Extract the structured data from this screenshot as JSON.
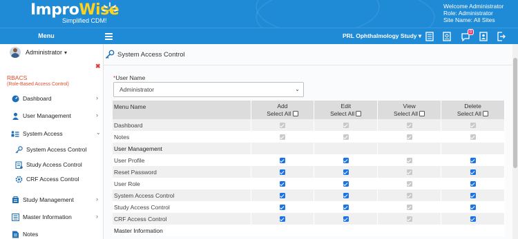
{
  "header": {
    "logo_part1": "Impro",
    "logo_part2": "Wise",
    "logo_tagline": "Simplified CDM!",
    "welcome_line": "Welcome  Administrator",
    "role_line": "Role:  Administrator",
    "site_line": "Site Name:  All Sites",
    "brand_color": "#1f8ad6",
    "accent_color": "#ffd21c"
  },
  "navbar": {
    "menu_label": "Menu",
    "study_selector": "PRL Ophthalmology Study",
    "notification_count": "0",
    "icons": [
      "hamburger-icon",
      "document-icon",
      "id-card-icon",
      "chat-icon",
      "user-card-icon",
      "logout-icon"
    ]
  },
  "sidebar": {
    "user_name": "Administrator",
    "module_title": "RBACS",
    "module_subtitle": "(Role-Based Access Control)",
    "items": [
      {
        "label": "Dashboard",
        "icon": "dashboard-icon"
      },
      {
        "label": "User Management",
        "icon": "user-icon"
      },
      {
        "label": "System Access",
        "icon": "system-access-icon"
      },
      {
        "label": "System Access Control",
        "icon": "key-icon"
      },
      {
        "label": "Study Access Control",
        "icon": "study-access-icon"
      },
      {
        "label": "CRF Access Control",
        "icon": "crf-icon"
      },
      {
        "label": "Study Management",
        "icon": "study-management-icon"
      },
      {
        "label": "Master Information",
        "icon": "master-info-icon"
      },
      {
        "label": "Notes",
        "icon": "notes-icon"
      }
    ]
  },
  "main": {
    "page_title": "System Access Control",
    "user_name_label": "User Name",
    "user_name_value": "Administrator",
    "table": {
      "col_menu": "Menu Name",
      "col_add": "Add",
      "col_edit": "Edit",
      "col_view": "View",
      "col_delete": "Delete",
      "select_all": "Select All",
      "rows": [
        {
          "name": "Dashboard",
          "add": "disabled",
          "edit": "disabled",
          "view": "disabled",
          "delete": "disabled"
        },
        {
          "name": "Notes",
          "add": "disabled",
          "edit": "disabled",
          "view": "disabled",
          "delete": "disabled"
        },
        {
          "name": "User Management",
          "section": true
        },
        {
          "name": "User Profile",
          "add": "checked",
          "edit": "checked",
          "view": "disabled",
          "delete": "checked"
        },
        {
          "name": "Reset Password",
          "add": "checked",
          "edit": "checked",
          "view": "disabled",
          "delete": "checked"
        },
        {
          "name": "User Role",
          "add": "checked",
          "edit": "checked",
          "view": "disabled",
          "delete": "checked"
        },
        {
          "name": "System Access Control",
          "add": "checked",
          "edit": "checked",
          "view": "disabled",
          "delete": "checked"
        },
        {
          "name": "Study Access Control",
          "add": "checked",
          "edit": "checked",
          "view": "disabled",
          "delete": "checked"
        },
        {
          "name": "CRF Access Control",
          "add": "checked",
          "edit": "checked",
          "view": "disabled",
          "delete": "checked"
        },
        {
          "name": "Master Information",
          "section": true
        }
      ]
    }
  }
}
